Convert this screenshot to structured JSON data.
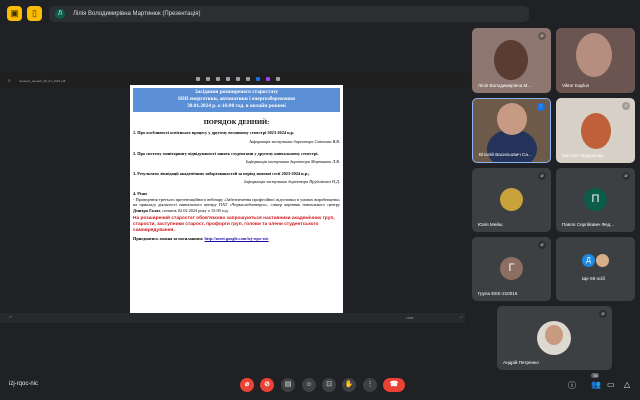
{
  "top": {
    "presenter_initial": "Л",
    "presenter_title": "Лілія Володимирівна Мартинюк (Презентація)"
  },
  "viewer": {
    "filename": "порядок_денний_30_01_2024.pdf",
    "zoom": "123%"
  },
  "doc": {
    "header": [
      "Засідання розширеного старостату",
      "ННІ енергетики, автоматики і енергозбереження",
      "30.01.2024 р. о 16:00 год. в онлайн режимі"
    ],
    "agenda_title": "ПОРЯДОК  ДЕННИЙ:",
    "items": [
      {
        "text": "1. Про особливості освітнього процесу у другому весняному семестрі 2023-2024 н.р.",
        "info": "Інформація заступника директора Савченка В.В."
      },
      {
        "text": "2. Про систему моніторингу відвідуваності занять студентами у другому навчальному семестрі.",
        "info": "Інформація заступника директора Мартинюк Л.В."
      },
      {
        "text": "3. Результати ліквідації академічних заборгованостей за період зимової сесії 2023-2024 н.р.;",
        "info": "Інформація заступника директора Прудніковоі Н.Д."
      }
    ],
    "misc_title": "4. Різне",
    "misc_text": "- Проведення третього презентаційного вебінару «Забезпечення професійної підготовки в умовах виробництва» на прикладі діяльності навчального центру ПАТ «Черкасиобленерго», спікер керівник навчального центру",
    "misc_speaker": "Дмитро Галат",
    "misc_time": ", початок 02.02.2024 року о 15:00 год.",
    "notice": "На розширений старостат обов'язково запрошуються наставники академічних груп, старости, заступники старост, профорги груп, голови та члени студентського самоврядування.",
    "join_label": "Приєднатись можна за посиланням:",
    "join_link": "http://meet.google.com/izj-rqoc-nic"
  },
  "participants": [
    {
      "name": "Лілія Володимирівна М..."
    },
    {
      "name": "Viktor Kaplun"
    },
    {
      "name": "Віталій Васильович Са..."
    },
    {
      "name": "Наталія Пруднікова"
    },
    {
      "name": "Юлія Мейш"
    },
    {
      "name": "Павло Сергійович Фед...",
      "initial": "П"
    },
    {
      "name": "Група ЕЕЕ-210016",
      "initial": "Г"
    },
    {
      "name": "Ще 69 осіб",
      "initial": "Д"
    },
    {
      "name": "Андрій Петренко"
    }
  ],
  "bottom": {
    "meeting_code": "izj-rqoc-nic",
    "people_count": "78"
  }
}
